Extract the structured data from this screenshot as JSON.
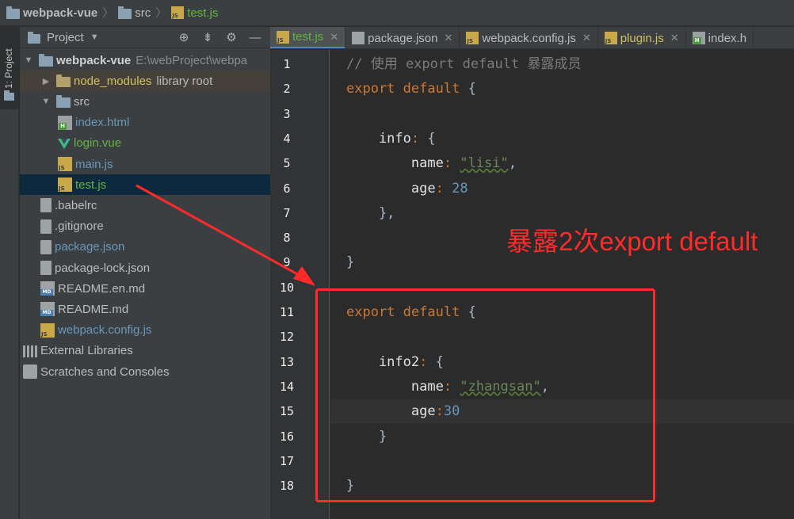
{
  "breadcrumb": {
    "project": "webpack-vue",
    "folder": "src",
    "file": "test.js"
  },
  "toolstrip": {
    "project_tab": "1: Project"
  },
  "panel": {
    "title": "Project",
    "tools": [
      "target-icon",
      "collapse-icon",
      "gear-icon",
      "minimize-icon"
    ]
  },
  "tree": [
    {
      "label": "webpack-vue",
      "extra": "E:\\webProject\\webpa",
      "icon": "folder-icon",
      "indent": 0,
      "arrow": "▼",
      "style": "bold"
    },
    {
      "label": "node_modules",
      "extra": "library root",
      "icon": "folder-icon",
      "indent": 1,
      "arrow": "▶",
      "style": "yellow"
    },
    {
      "label": "src",
      "extra": "",
      "icon": "folder-icon",
      "indent": 1,
      "arrow": "▼",
      "style": ""
    },
    {
      "label": "index.html",
      "extra": "",
      "icon": "html-file-icon",
      "indent": 2,
      "arrow": "",
      "style": "blue"
    },
    {
      "label": "login.vue",
      "extra": "",
      "icon": "vue-file-icon",
      "indent": 2,
      "arrow": "",
      "style": "green"
    },
    {
      "label": "main.js",
      "extra": "",
      "icon": "js-file-icon",
      "indent": 2,
      "arrow": "",
      "style": "blue"
    },
    {
      "label": "test.js",
      "extra": "",
      "icon": "js-file-icon",
      "indent": 2,
      "arrow": "",
      "style": "green"
    },
    {
      "label": ".babelrc",
      "extra": "",
      "icon": "config-file-icon",
      "indent": 1,
      "arrow": "",
      "style": ""
    },
    {
      "label": ".gitignore",
      "extra": "",
      "icon": "text-file-icon",
      "indent": 1,
      "arrow": "",
      "style": ""
    },
    {
      "label": "package.json",
      "extra": "",
      "icon": "json-file-icon",
      "indent": 1,
      "arrow": "",
      "style": "blue"
    },
    {
      "label": "package-lock.json",
      "extra": "",
      "icon": "json-file-icon",
      "indent": 1,
      "arrow": "",
      "style": ""
    },
    {
      "label": "README.en.md",
      "extra": "",
      "icon": "md-file-icon",
      "indent": 1,
      "arrow": "",
      "style": ""
    },
    {
      "label": "README.md",
      "extra": "",
      "icon": "md-file-icon",
      "indent": 1,
      "arrow": "",
      "style": ""
    },
    {
      "label": "webpack.config.js",
      "extra": "",
      "icon": "js-file-icon",
      "indent": 1,
      "arrow": "",
      "style": "blue"
    },
    {
      "label": "External Libraries",
      "extra": "",
      "icon": "libraries-icon",
      "indent": 0,
      "arrow": "",
      "style": ""
    },
    {
      "label": "Scratches and Consoles",
      "extra": "",
      "icon": "scratches-icon",
      "indent": 0,
      "arrow": "",
      "style": ""
    }
  ],
  "tabs": [
    {
      "label": "test.js",
      "icon": "js-file-icon",
      "active": true,
      "color": "#62b543"
    },
    {
      "label": "package.json",
      "icon": "json-file-icon",
      "active": false,
      "color": "#bbbbbb"
    },
    {
      "label": "webpack.config.js",
      "icon": "js-file-icon",
      "active": false,
      "color": "#bbbbbb"
    },
    {
      "label": "plugin.js",
      "icon": "js-file-icon",
      "active": false,
      "color": "#d0c160"
    },
    {
      "label": "index.h",
      "icon": "html-file-icon",
      "active": false,
      "color": "#bbbbbb"
    }
  ],
  "editor": {
    "current_line": 15,
    "lines": [
      [
        {
          "t": "// 使用 export default 暴露成员",
          "c": "cm"
        }
      ],
      [
        {
          "t": "export",
          "c": "kw"
        },
        {
          "t": " "
        },
        {
          "t": "default",
          "c": "kw"
        },
        {
          "t": " {"
        }
      ],
      [],
      [
        {
          "t": "    info",
          "c": "prop"
        },
        {
          "t": ":",
          "c": "kw"
        },
        {
          "t": " {"
        }
      ],
      [
        {
          "t": "        name",
          "c": "prop"
        },
        {
          "t": ":",
          "c": "kw"
        },
        {
          "t": " "
        },
        {
          "t": "\"lisi\"",
          "c": "str"
        },
        {
          "t": ","
        }
      ],
      [
        {
          "t": "        age",
          "c": "prop"
        },
        {
          "t": ":",
          "c": "kw"
        },
        {
          "t": " "
        },
        {
          "t": "28",
          "c": "num"
        }
      ],
      [
        {
          "t": "    },"
        }
      ],
      [],
      [
        {
          "t": "}"
        }
      ],
      [],
      [
        {
          "t": "export",
          "c": "kw"
        },
        {
          "t": " "
        },
        {
          "t": "default",
          "c": "kw"
        },
        {
          "t": " {"
        }
      ],
      [],
      [
        {
          "t": "    info2",
          "c": "prop"
        },
        {
          "t": ":",
          "c": "kw"
        },
        {
          "t": " {"
        }
      ],
      [
        {
          "t": "        name",
          "c": "prop"
        },
        {
          "t": ":",
          "c": "kw"
        },
        {
          "t": " "
        },
        {
          "t": "\"zhangsan\"",
          "c": "str"
        },
        {
          "t": ","
        }
      ],
      [
        {
          "t": "        age",
          "c": "prop"
        },
        {
          "t": ":",
          "c": "kw"
        },
        {
          "t": "30",
          "c": "num"
        }
      ],
      [
        {
          "t": "    }"
        }
      ],
      [],
      [
        {
          "t": "}"
        }
      ]
    ]
  },
  "annotation": {
    "text": "暴露2次export default",
    "color": "#ff2a2a"
  }
}
